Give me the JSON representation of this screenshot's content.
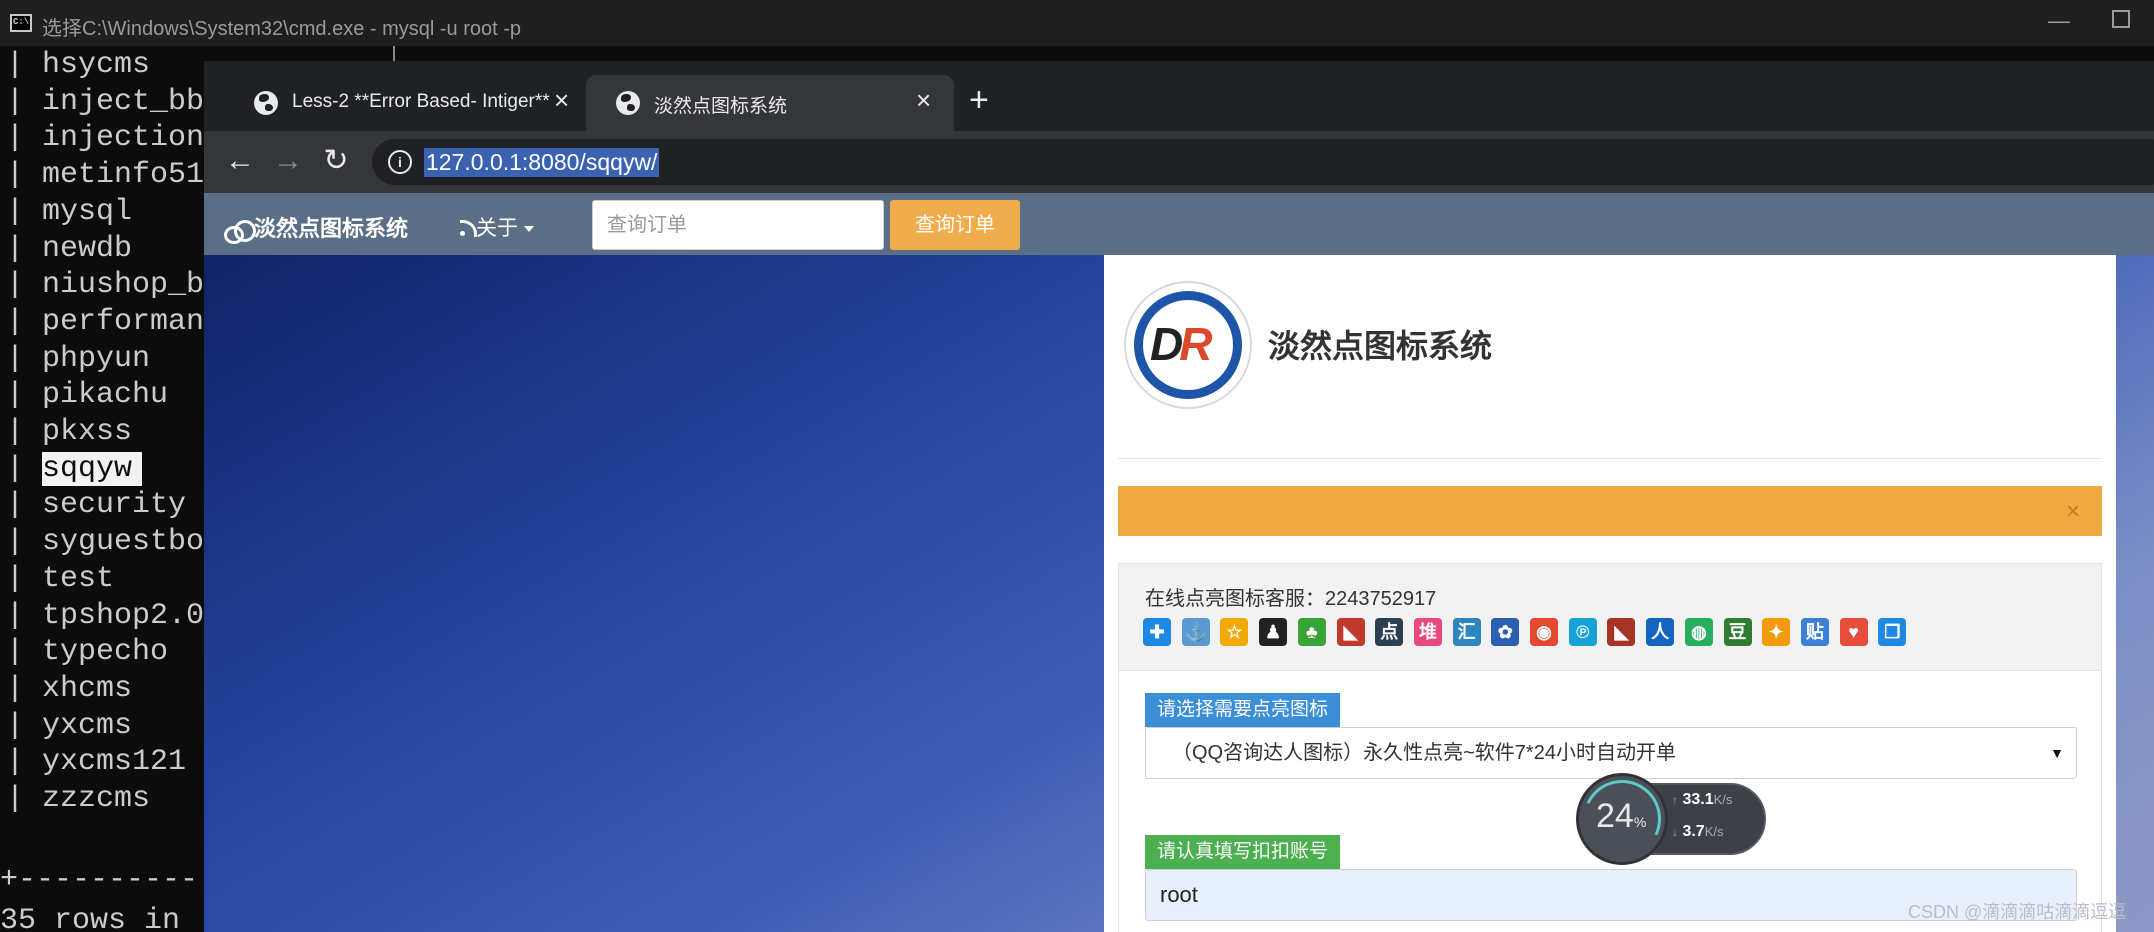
{
  "cmd": {
    "title": "选择C:\\Windows\\System32\\cmd.exe - mysql  -u root -p",
    "databases": [
      "hsycms",
      "inject_bb",
      "injection",
      "metinfo51",
      "mysql",
      "newdb",
      "niushop_b",
      "performanc",
      "phpyun",
      "pikachu",
      "pkxss",
      "sqqyw",
      "security",
      "syguestboo",
      "test",
      "tpshop2.0",
      "typecho",
      "xhcms",
      "yxcms",
      "yxcms121",
      "zzzcms"
    ],
    "selected_index": 11,
    "separator": "+----------",
    "rows_text": "35 rows in"
  },
  "browser": {
    "tabs": [
      {
        "label": "Less-2 **Error Based- Intiger**",
        "active": false
      },
      {
        "label": "淡然点图标系统",
        "active": true
      }
    ],
    "new_tab_symbol": "+",
    "url": "127.0.0.1:8080/sqqyw/"
  },
  "site": {
    "brand": "淡然点图标系统",
    "about": "关于",
    "order_placeholder": "查询订单",
    "order_button": "查询订单",
    "logo_text": "DR",
    "site_name": "淡然点图标系统",
    "alert_close": "×",
    "service_text": "在线点亮图标客服：2243752917",
    "service_icons": [
      {
        "name": "plus-icon",
        "glyph": "✚",
        "color": "#1e88e5"
      },
      {
        "name": "anchor-icon",
        "glyph": "⚓",
        "color": "#5b9bd5"
      },
      {
        "name": "star-icon",
        "glyph": "☆",
        "color": "#f2a900"
      },
      {
        "name": "qq-penguin-icon",
        "glyph": "♟",
        "color": "#222222"
      },
      {
        "name": "clover-icon",
        "glyph": "♣",
        "color": "#3aa335"
      },
      {
        "name": "flag-red-icon",
        "glyph": "◣",
        "color": "#c0392b"
      },
      {
        "name": "dian-icon",
        "glyph": "点",
        "color": "#2c3e50"
      },
      {
        "name": "dui-icon",
        "glyph": "堆",
        "color": "#e84a7a"
      },
      {
        "name": "hui-icon",
        "glyph": "汇",
        "color": "#2e86c1"
      },
      {
        "name": "paw-icon",
        "glyph": "✿",
        "color": "#2b5fb4"
      },
      {
        "name": "weibo-icon",
        "glyph": "◉",
        "color": "#e6492f"
      },
      {
        "name": "p-icon",
        "glyph": "℗",
        "color": "#17a2d8"
      },
      {
        "name": "flag-dark-icon",
        "glyph": "◣",
        "color": "#a93226"
      },
      {
        "name": "person-icon",
        "glyph": "人",
        "color": "#1565c0"
      },
      {
        "name": "wechat-icon",
        "glyph": "◍",
        "color": "#27ae60"
      },
      {
        "name": "dou-icon",
        "glyph": "豆",
        "color": "#2e7d32"
      },
      {
        "name": "pinwheel-icon",
        "glyph": "✦",
        "color": "#f39c12"
      },
      {
        "name": "tie-icon",
        "glyph": "贴",
        "color": "#3d7fd6"
      },
      {
        "name": "heart-icon",
        "glyph": "♥",
        "color": "#e74c3c"
      },
      {
        "name": "copy-icon",
        "glyph": "❐",
        "color": "#1e88e5"
      }
    ],
    "label_icon": "请选择需要点亮图标",
    "icon_select_value": "（QQ咨询达人图标）永久性点亮~软件7*24小时自动开单",
    "label_qq": "请认真填写扣扣账号",
    "qq_value": "root"
  },
  "netspeed": {
    "percent": "24",
    "percent_unit": "%",
    "upload": "33.1",
    "download": "3.7",
    "unit": "K/s"
  },
  "watermark": "CSDN @滴滴滴咕滴滴逗逗"
}
